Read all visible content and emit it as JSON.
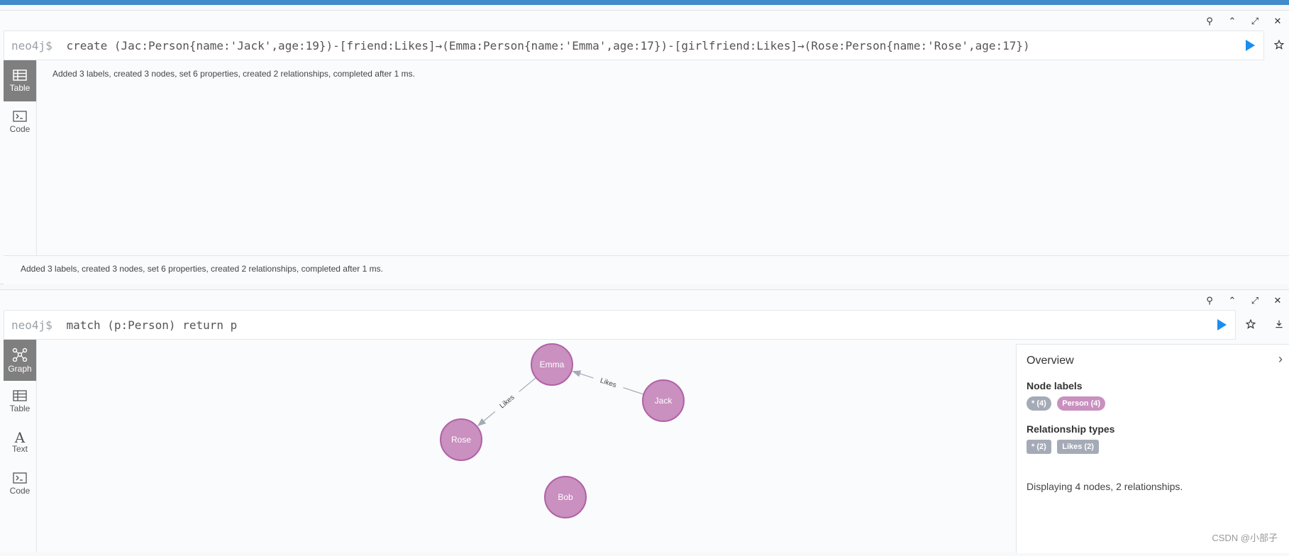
{
  "frame1": {
    "prompt": "neo4j$",
    "command": "create (Jac:Person{name:'Jack',age:19})-[friend:Likes]→(Emma:Person{name:'Emma',age:17})-[girlfriend:Likes]→(Rose:Person{name:'Rose',age:17})",
    "tabs": [
      {
        "label": "Table",
        "icon": "table-icon",
        "active": true
      },
      {
        "label": "Code",
        "icon": "code-icon",
        "active": false
      }
    ],
    "result_message": "Added 3 labels, created 3 nodes, set 6 properties, created 2 relationships, completed after 1 ms.",
    "status_message": "Added 3 labels, created 3 nodes, set 6 properties, created 2 relationships, completed after 1 ms."
  },
  "frame2": {
    "prompt": "neo4j$",
    "command": "match (p:Person) return p",
    "tabs": [
      {
        "label": "Graph",
        "icon": "graph-icon",
        "active": true
      },
      {
        "label": "Table",
        "icon": "table-icon",
        "active": false
      },
      {
        "label": "Text",
        "icon": "text-icon",
        "active": false
      },
      {
        "label": "Code",
        "icon": "code-icon",
        "active": false
      }
    ]
  },
  "graph": {
    "node_color": "#c990c0",
    "node_border": "#b261a5",
    "nodes": [
      {
        "id": "emma",
        "label": "Emma"
      },
      {
        "id": "jack",
        "label": "Jack"
      },
      {
        "id": "rose",
        "label": "Rose"
      },
      {
        "id": "bob",
        "label": "Bob"
      }
    ],
    "relationships": [
      {
        "from": "jack",
        "to": "emma",
        "type": "Likes"
      },
      {
        "from": "emma",
        "to": "rose",
        "type": "Likes"
      }
    ]
  },
  "overview": {
    "title": "Overview",
    "node_labels_heading": "Node labels",
    "node_labels": [
      {
        "text": "* (4)",
        "color": "#a5abb6"
      },
      {
        "text": "Person (4)",
        "color": "#c990c0"
      }
    ],
    "rel_types_heading": "Relationship types",
    "rel_types": [
      {
        "text": "* (2)",
        "color": "#a5abb6"
      },
      {
        "text": "Likes (2)",
        "color": "#a5abb6"
      }
    ],
    "footer": "Displaying 4 nodes, 2 relationships."
  },
  "watermark": "CSDN @小部子",
  "colors": {
    "accent": "#428bca",
    "run": "#1a8ef0",
    "active_tab": "#7f7f7f"
  }
}
